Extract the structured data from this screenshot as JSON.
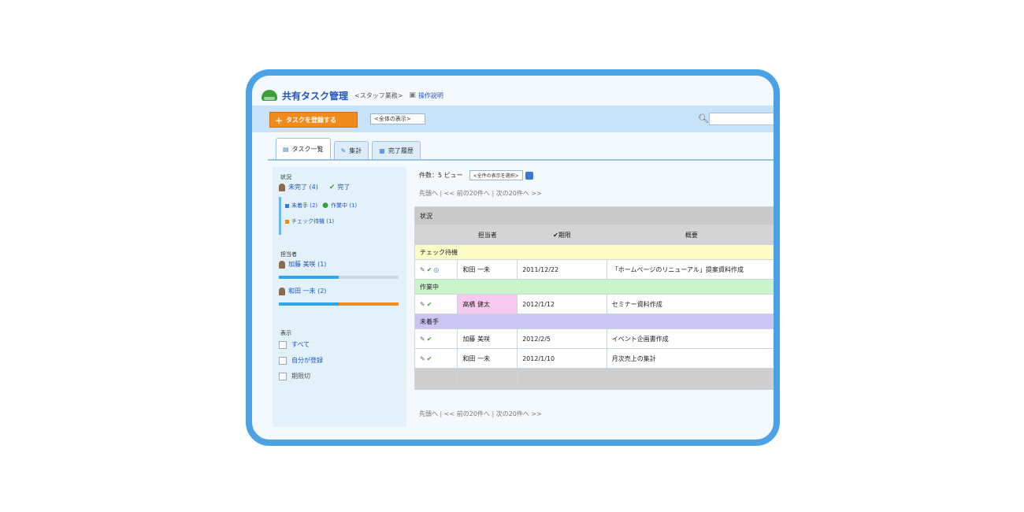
{
  "app": {
    "title": "共有タスク管理",
    "subtitle": "<スタッフ業務>",
    "help_link": "操作説明"
  },
  "toolbar": {
    "new_button": "タスクを登録する",
    "filter_select": "<全体の表示>",
    "search_value": ""
  },
  "tabs": [
    {
      "label": "タスク一覧",
      "icon": "list-icon"
    },
    {
      "label": "集計",
      "icon": "chart-icon"
    },
    {
      "label": "完了履歴",
      "icon": "history-icon"
    }
  ],
  "sidebar": {
    "status_heading": "状況",
    "incomplete": "未完了 (4)",
    "complete": "完了",
    "in_progress": "未着手 (2)",
    "unstarted": "作業中 (1)",
    "check_waiting": "チェック待機 (1)",
    "assignee_heading": "担当者",
    "assignee1": "加藤 美咲 (1)",
    "assignee2": "和田 一未 (2)",
    "assignee1_progress": 0.5,
    "assignee2_progress_blue": 0.5,
    "assignee2_progress_orange": 0.5,
    "other_heading": "表示",
    "all": "すべて",
    "mine": "自分が登録",
    "done": "期限切"
  },
  "main": {
    "topline": "件数：5  ビュー",
    "view_select": "<全件の表示を選択>",
    "pager_top": "先頭へ | << 前の20件へ | 次の20件へ >>",
    "pager_bottom": "先頭へ | << 前の20件へ | 次の20件へ >>",
    "status_header": "状況",
    "columns": [
      "",
      "担当者",
      "✔期限",
      "概要"
    ],
    "groups": [
      {
        "label": "チェック待機",
        "color": "#fffdc7",
        "rows": [
          {
            "assignee": "和田 一未",
            "due": "2011/12/22",
            "subject": "「ホームページのリニューアル」提案資料作成"
          }
        ]
      },
      {
        "label": "作業中",
        "color": "#cdf5cd",
        "rows": [
          {
            "assignee": "高橋 健太",
            "due": "2012/1/12",
            "subject": "セミナー資料作成",
            "highlight": true
          }
        ]
      },
      {
        "label": "未着手",
        "color": "#cbc5f2",
        "rows": [
          {
            "assignee": "加藤 美咲",
            "due": "2012/2/5",
            "subject": "イベント企画書作成"
          },
          {
            "assignee": "和田 一未",
            "due": "2012/1/10",
            "subject": "月次売上の集計"
          }
        ]
      }
    ]
  }
}
